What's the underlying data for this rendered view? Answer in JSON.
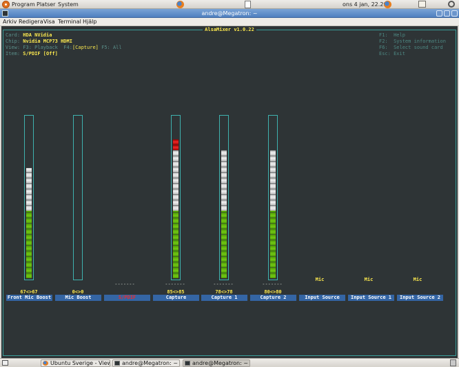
{
  "top_panel": {
    "menus": [
      "Program",
      "Platser",
      "System"
    ],
    "clock": "ons  4 jan, 22.20"
  },
  "window": {
    "title": "andre@Megatron: ~",
    "menubar": [
      "Arkiv",
      "Redigera",
      "Visa",
      "Terminal",
      "Hjälp"
    ]
  },
  "mixer": {
    "title": "AlsaMixer v1.0.22",
    "info": {
      "card_label": "Card: ",
      "card_value": "HDA NVidia",
      "chip_label": "Chip: ",
      "chip_value": "Nvidia MCP73 HDMI",
      "view_label": "View: ",
      "view_playback": "F3: Playback  F4:",
      "view_capture": "[Capture]",
      "view_all": " F5: All",
      "item_label": "Item: ",
      "item_value": "S/PDIF [Off]"
    },
    "help": [
      "F1:  Help",
      "F2:  System information",
      "F6:  Select sound card",
      "Esc: Exit"
    ],
    "controls": [
      {
        "name": "Front Mic Boost",
        "value": "67<>67",
        "level": 67
      },
      {
        "name": "Mic Boost",
        "value": "0<>0",
        "level": 0
      },
      {
        "name": "S/PDIF",
        "dashes": "-------"
      },
      {
        "name": "Capture",
        "value": "85<>85",
        "dashes": "-------",
        "level": 85
      },
      {
        "name": "Capture 1",
        "value": "78<>78",
        "dashes": "-------",
        "level": 78
      },
      {
        "name": "Capture 2",
        "value": "80<>80",
        "dashes": "-------",
        "level": 80
      },
      {
        "name": "Input Source",
        "value": "Mic"
      },
      {
        "name": "Input Source 1",
        "value": "Mic"
      },
      {
        "name": "Input Source 2",
        "value": "Mic"
      }
    ]
  },
  "bottom_panel": {
    "tasks": [
      "Ubuntu Sverige - View...",
      "andre@Megatron: ~",
      "andre@Megatron: ~"
    ]
  },
  "colors": {
    "terminal_bg": "#2e3436",
    "accent_yellow": "#fce94f",
    "frame_cyan": "#3fb3b0",
    "label_blue": "#3465a4",
    "meter_green": "#73c914",
    "meter_red": "#ef2929"
  }
}
